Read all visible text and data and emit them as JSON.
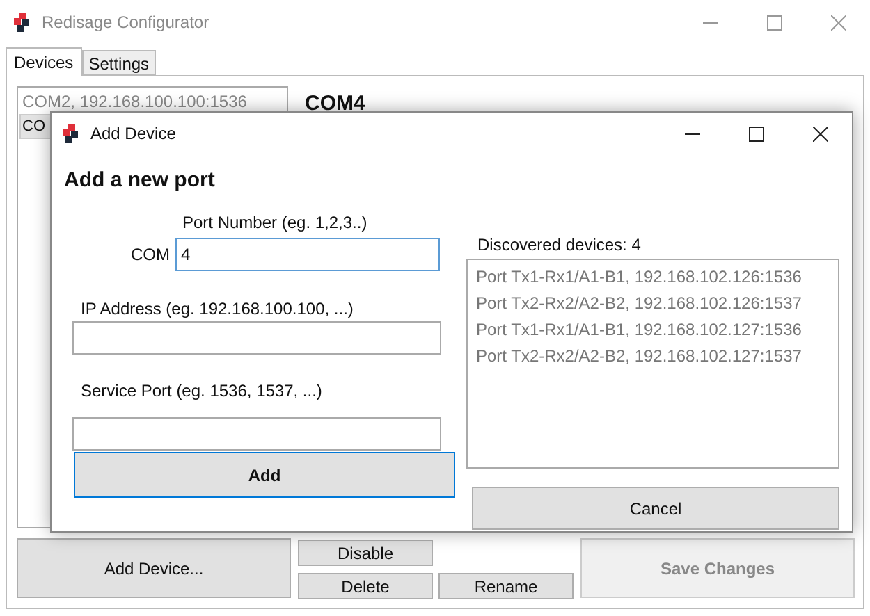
{
  "window": {
    "title": "Redisage Configurator"
  },
  "tabs": [
    {
      "label": "Devices",
      "selected": true
    },
    {
      "label": "Settings",
      "selected": false
    }
  ],
  "device_list": [
    {
      "label": "COM2, 192.168.100.100:1536",
      "selected": false
    },
    {
      "label": "CO",
      "selected": true
    }
  ],
  "device_header": "COM4",
  "buttons": {
    "add_device": "Add Device...",
    "disable": "Disable",
    "delete": "Delete",
    "rename": "Rename",
    "save_changes": {
      "label": "Save Changes",
      "disabled": true
    }
  },
  "dialog": {
    "title": "Add Device",
    "heading": "Add a new port",
    "port_label": "Port Number (eg. 1,2,3..)",
    "com_label": "COM",
    "port_field": {
      "value": "4",
      "focused": true
    },
    "ip_label": "IP Address (eg. 192.168.100.100, ...)",
    "service_label": "Service Port (eg. 1536, 1537, ...)",
    "discovered_label": "Discovered devices: 4",
    "discovered": [
      "Port Tx1-Rx1/A1-B1, 192.168.102.126:1536",
      "Port Tx2-Rx2/A2-B2, 192.168.102.126:1537",
      "Port Tx1-Rx1/A1-B1, 192.168.102.127:1536",
      "Port Tx2-Rx2/A2-B2, 192.168.102.127:1537"
    ],
    "add_button": {
      "label": "Add",
      "default": true
    },
    "cancel_button": "Cancel"
  }
}
